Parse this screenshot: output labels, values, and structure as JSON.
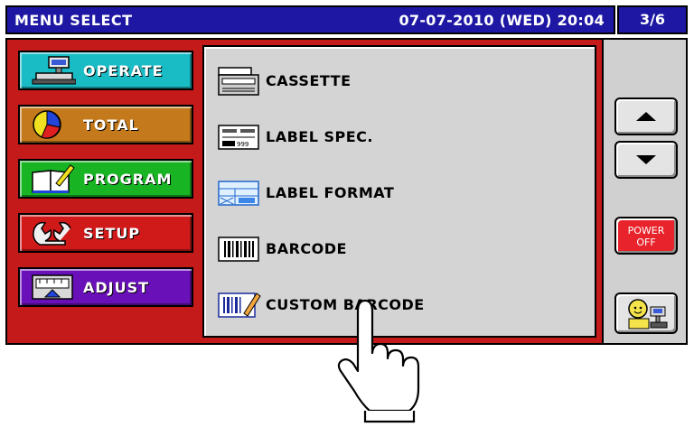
{
  "titlebar": {
    "title": "MENU SELECT",
    "datetime": "07-07-2010 (WED) 20:04",
    "page": "3/6"
  },
  "categories": [
    {
      "label": "OPERATE",
      "color": "#19bcc4",
      "icon": "scale-icon"
    },
    {
      "label": "TOTAL",
      "color": "#c47a1c",
      "icon": "pie-chart-icon"
    },
    {
      "label": "PROGRAM",
      "color": "#18b424",
      "icon": "book-pen-icon"
    },
    {
      "label": "SETUP",
      "color": "#d01a1a",
      "icon": "wrench-icon"
    },
    {
      "label": "ADJUST",
      "color": "#6a10b8",
      "icon": "adjust-gauge-icon"
    }
  ],
  "items": [
    {
      "label": "CASSETTE",
      "icon": "cassette-icon"
    },
    {
      "label": "LABEL SPEC.",
      "icon": "label-spec-icon"
    },
    {
      "label": "LABEL FORMAT",
      "icon": "label-format-icon"
    },
    {
      "label": "BARCODE",
      "icon": "barcode-icon"
    },
    {
      "label": "CUSTOM BARCODE",
      "icon": "custom-barcode-icon"
    }
  ],
  "side": {
    "power_label_1": "POWER",
    "power_label_2": "OFF",
    "power_color": "#e8232b"
  }
}
